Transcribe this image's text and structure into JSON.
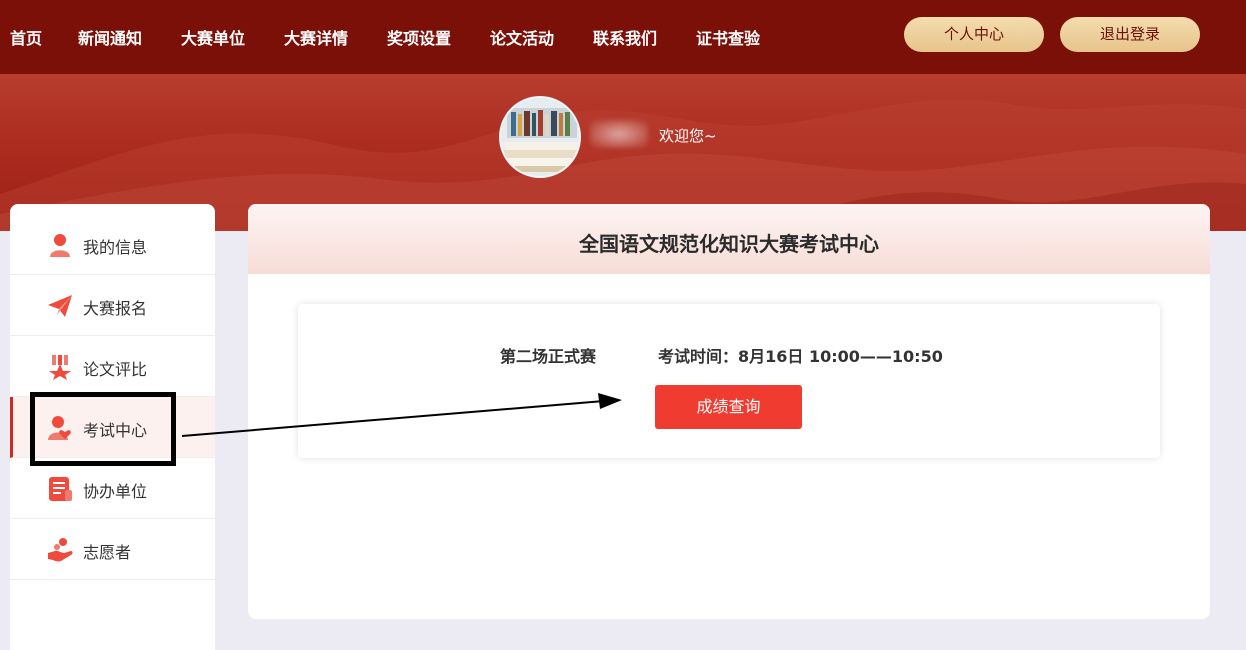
{
  "nav": {
    "items": [
      "首页",
      "新闻通知",
      "大赛单位",
      "大赛详情",
      "奖项设置",
      "论文活动",
      "联系我们",
      "证书查验"
    ],
    "personal_center": "个人中心",
    "logout": "退出登录"
  },
  "hero": {
    "welcome": "欢迎您~"
  },
  "sidebar": {
    "items": [
      {
        "label": "我的信息",
        "icon": "user-icon"
      },
      {
        "label": "大赛报名",
        "icon": "paper-plane-icon"
      },
      {
        "label": "论文评比",
        "icon": "medal-icon"
      },
      {
        "label": "考试中心",
        "icon": "user-heart-icon",
        "active": true
      },
      {
        "label": "协办单位",
        "icon": "document-list-icon"
      },
      {
        "label": "志愿者",
        "icon": "helping-hand-icon"
      }
    ]
  },
  "main": {
    "title": "全国语文规范化知识大赛考试中心",
    "exam": {
      "name": "第二场正式赛",
      "time": "考试时间：8月16日 10:00——10:50",
      "button": "成绩查询"
    }
  },
  "colors": {
    "nav_bg": "#7b1009",
    "accent": "#ef3b30",
    "pill": "#f0d3a0"
  }
}
